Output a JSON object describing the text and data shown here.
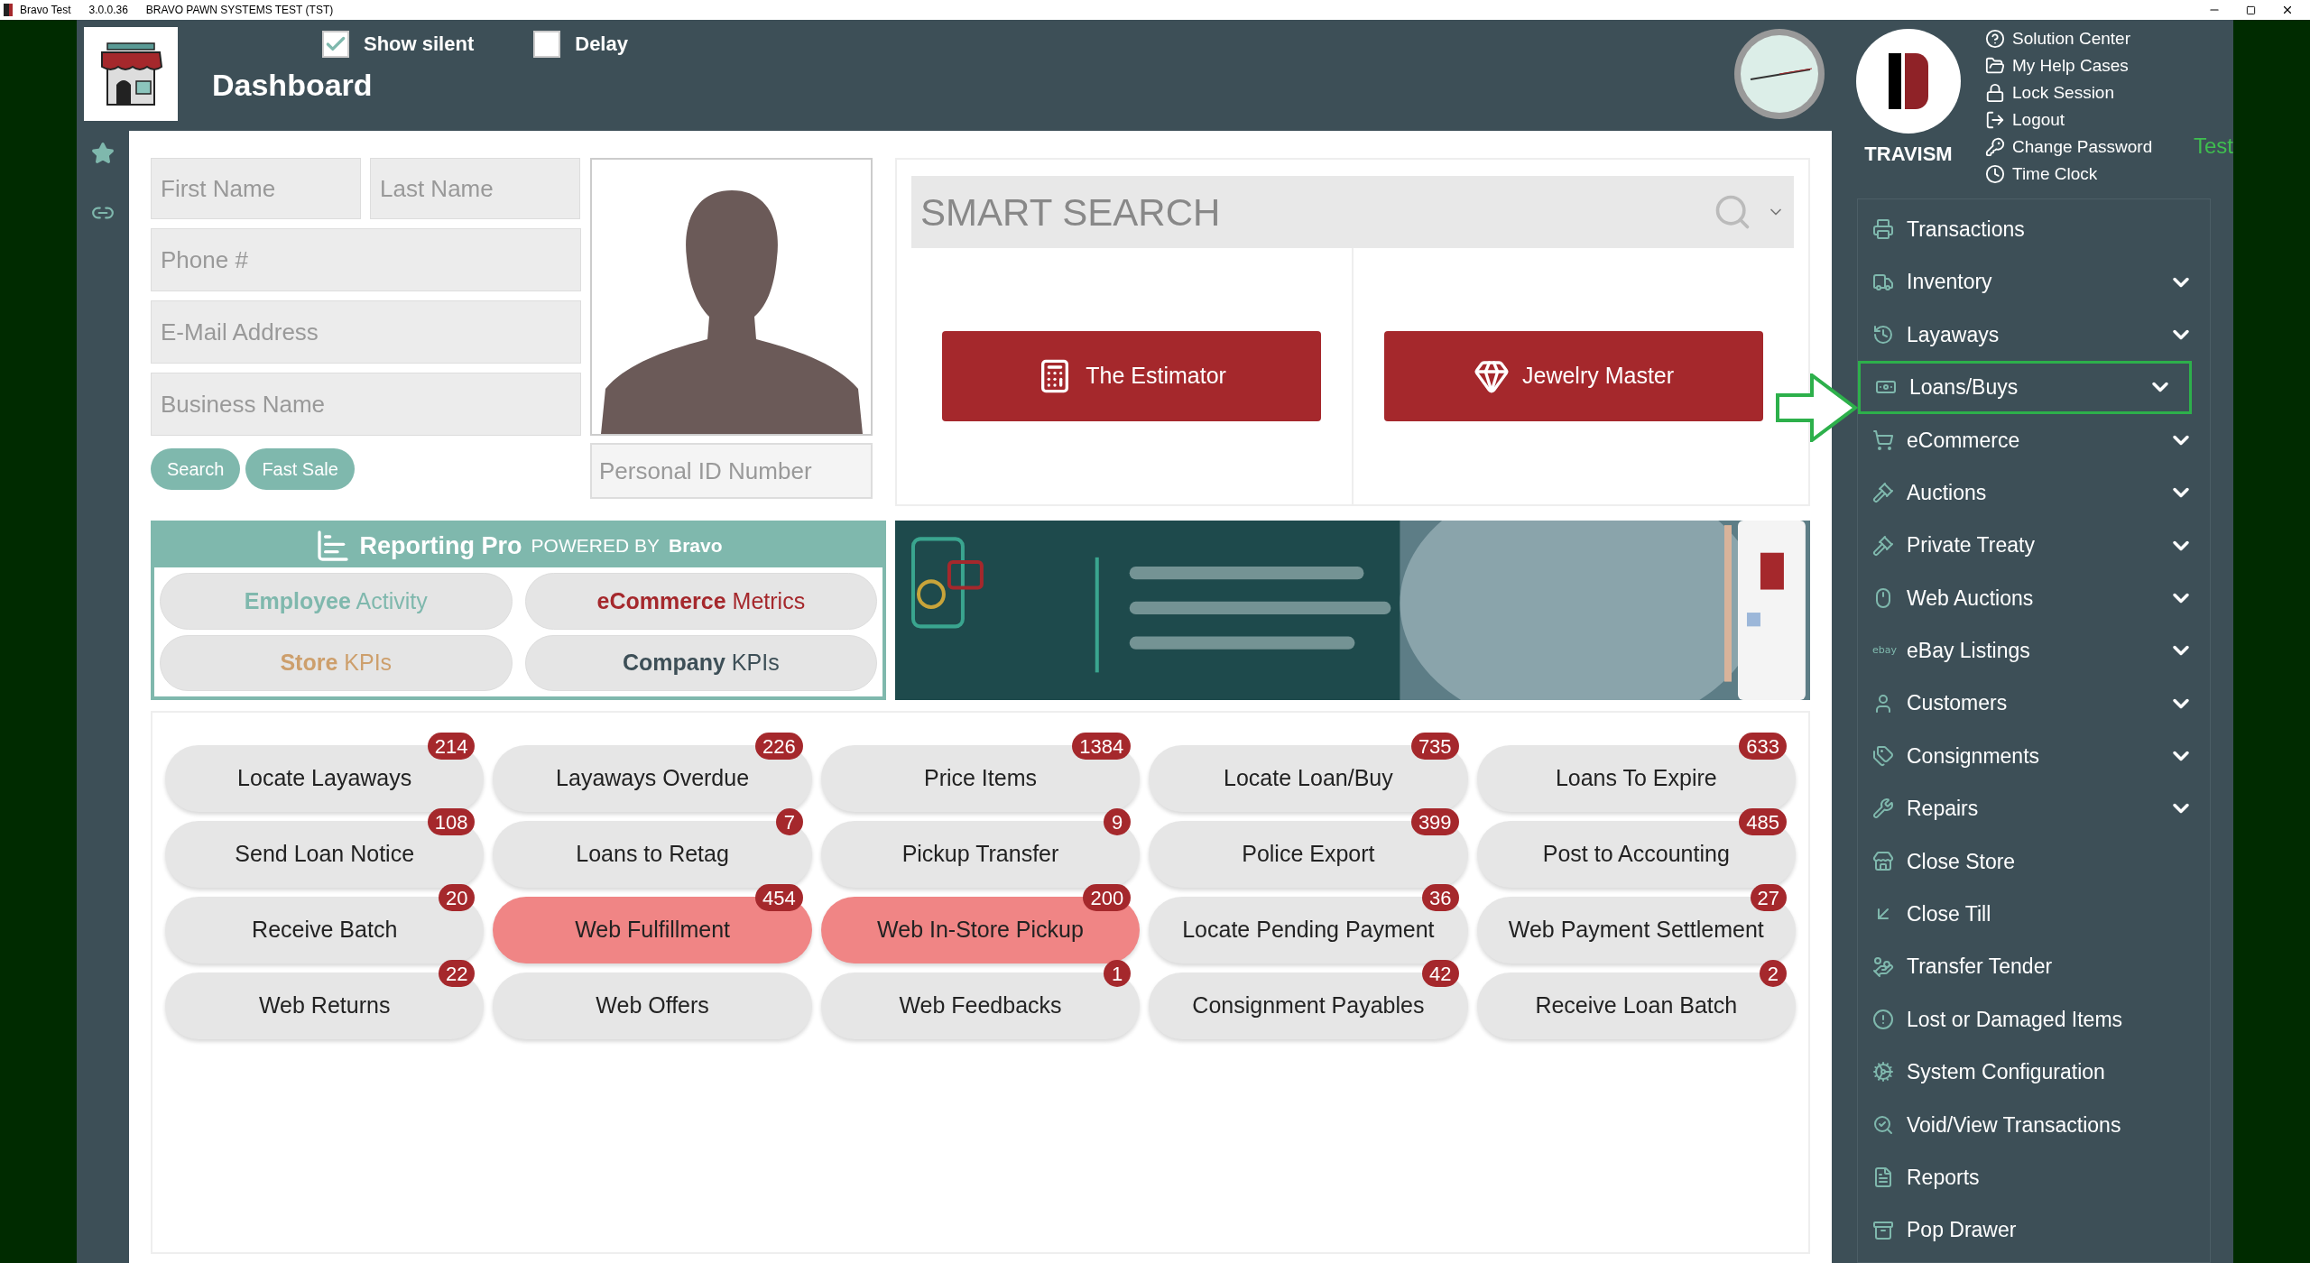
{
  "title_bar": {
    "app_name": "Bravo Test",
    "version": "3.0.0.36",
    "system": "BRAVO PAWN SYSTEMS TEST (TST)"
  },
  "header": {
    "title": "Dashboard",
    "checkboxes": [
      {
        "label": "Show silent",
        "checked": true
      },
      {
        "label": "Delay",
        "checked": false
      }
    ]
  },
  "user": {
    "name": "TRAVISM"
  },
  "help_links": [
    {
      "label": "Solution Center",
      "kind": "question"
    },
    {
      "label": "My Help Cases",
      "kind": "folder"
    },
    {
      "label": "Lock Session",
      "kind": "lock"
    },
    {
      "label": "Logout",
      "kind": "logout"
    },
    {
      "label": "Change Password",
      "kind": "key"
    },
    {
      "label": "Time Clock",
      "kind": "clock"
    }
  ],
  "environment_label": "Test",
  "customer_form": {
    "fields": [
      {
        "placeholder": "First Name"
      },
      {
        "placeholder": "Last Name"
      },
      {
        "placeholder": "Phone #"
      },
      {
        "placeholder": "E-Mail Address"
      },
      {
        "placeholder": "Business Name"
      }
    ],
    "buttons": [
      "Search",
      "Fast Sale"
    ],
    "id_field": {
      "placeholder": "Personal ID Number"
    }
  },
  "smart_search": {
    "placeholder": "SMART SEARCH"
  },
  "tools": [
    {
      "label": "The Estimator",
      "kind": "calculator"
    },
    {
      "label": "Jewelry Master",
      "kind": "diamond"
    }
  ],
  "reporting": {
    "title": "Reporting Pro",
    "powered_by": "POWERED BY",
    "brand": "Bravo",
    "buttons": [
      {
        "bold": "Employee",
        "rest": "Activity",
        "color": "#7fb8ad"
      },
      {
        "bold": "eCommerce",
        "rest": "Metrics",
        "color": "#a5282c"
      },
      {
        "bold": "Store",
        "rest": "KPIs",
        "color": "#cd9f6c"
      },
      {
        "bold": "Company",
        "rest": "KPIs",
        "color": "#3d4f57"
      }
    ]
  },
  "quick_actions": [
    {
      "label": "Locate Layaways",
      "count": "214",
      "highlighted": false
    },
    {
      "label": "Layaways Overdue",
      "count": "226",
      "highlighted": false
    },
    {
      "label": "Price Items",
      "count": "1384",
      "highlighted": false
    },
    {
      "label": "Locate Loan/Buy",
      "count": "735",
      "highlighted": false
    },
    {
      "label": "Loans To Expire",
      "count": "633",
      "highlighted": false
    },
    {
      "label": "Send Loan Notice",
      "count": "108",
      "highlighted": false
    },
    {
      "label": "Loans to Retag",
      "count": "7",
      "highlighted": false
    },
    {
      "label": "Pickup Transfer",
      "count": "9",
      "highlighted": false
    },
    {
      "label": "Police Export",
      "count": "399",
      "highlighted": false
    },
    {
      "label": "Post to Accounting",
      "count": "485",
      "highlighted": false
    },
    {
      "label": "Receive Batch",
      "count": "20",
      "highlighted": false
    },
    {
      "label": "Web Fulfillment",
      "count": "454",
      "highlighted": true
    },
    {
      "label": "Web In-Store Pickup",
      "count": "200",
      "highlighted": true
    },
    {
      "label": "Locate Pending Payment",
      "count": "36",
      "highlighted": false
    },
    {
      "label": "Web Payment Settlement",
      "count": "27",
      "highlighted": false
    },
    {
      "label": "Web Returns",
      "count": "22",
      "highlighted": false
    },
    {
      "label": "Web Offers",
      "highlighted": false
    },
    {
      "label": "Web Feedbacks",
      "count": "1",
      "highlighted": false
    },
    {
      "label": "Consignment Payables",
      "count": "42",
      "highlighted": false
    },
    {
      "label": "Receive Loan Batch",
      "count": "2",
      "highlighted": false
    }
  ],
  "nav": [
    {
      "label": "Transactions",
      "kind": "register",
      "expandable": false,
      "highlighted": false
    },
    {
      "label": "Inventory",
      "kind": "dolly",
      "expandable": true,
      "highlighted": false
    },
    {
      "label": "Layaways",
      "kind": "history",
      "expandable": true,
      "highlighted": false
    },
    {
      "label": "Loans/Buys",
      "kind": "money",
      "expandable": true,
      "highlighted": true
    },
    {
      "label": "eCommerce",
      "kind": "cart",
      "expandable": true,
      "highlighted": false
    },
    {
      "label": "Auctions",
      "kind": "gavel",
      "expandable": true,
      "highlighted": false
    },
    {
      "label": "Private Treaty",
      "kind": "gavel",
      "expandable": true,
      "highlighted": false
    },
    {
      "label": "Web Auctions",
      "kind": "mouse",
      "expandable": true,
      "highlighted": false
    },
    {
      "label": "eBay Listings",
      "kind": "ebay",
      "expandable": true,
      "highlighted": false
    },
    {
      "label": "Customers",
      "kind": "user",
      "expandable": true,
      "highlighted": false
    },
    {
      "label": "Consignments",
      "kind": "tags",
      "expandable": true,
      "highlighted": false
    },
    {
      "label": "Repairs",
      "kind": "wrench",
      "expandable": true,
      "highlighted": false
    },
    {
      "label": "Close Store",
      "kind": "store",
      "expandable": false,
      "highlighted": false
    },
    {
      "label": "Close Till",
      "kind": "till",
      "expandable": false,
      "highlighted": false
    },
    {
      "label": "Transfer Tender",
      "kind": "hand",
      "expandable": false,
      "highlighted": false
    },
    {
      "label": "Lost or Damaged Items",
      "kind": "alert",
      "expandable": false,
      "highlighted": false
    },
    {
      "label": "System Configuration",
      "kind": "cogs",
      "expandable": false,
      "highlighted": false
    },
    {
      "label": "Void/View Transactions",
      "kind": "search",
      "expandable": false,
      "highlighted": false
    },
    {
      "label": "Reports",
      "kind": "file",
      "expandable": false,
      "highlighted": false
    },
    {
      "label": "Pop Drawer",
      "kind": "drawer",
      "expandable": false,
      "highlighted": false
    }
  ]
}
